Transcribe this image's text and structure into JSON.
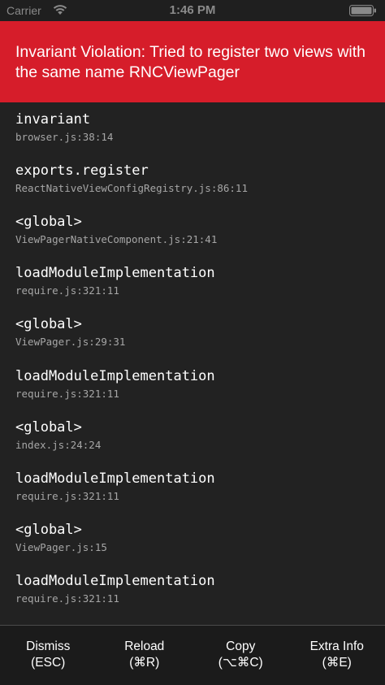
{
  "status_bar": {
    "carrier": "Carrier",
    "time": "1:46 PM",
    "icons": [
      "wifi-icon",
      "battery-icon"
    ]
  },
  "error": {
    "title": "Invariant Violation: Tried to register two views with the same name RNCViewPager",
    "background_color": "#d61d2a"
  },
  "stack": [
    {
      "method": "invariant",
      "location": "browser.js:38:14"
    },
    {
      "method": "exports.register",
      "location": "ReactNativeViewConfigRegistry.js:86:11"
    },
    {
      "method": "<global>",
      "location": "ViewPagerNativeComponent.js:21:41"
    },
    {
      "method": "loadModuleImplementation",
      "location": "require.js:321:11"
    },
    {
      "method": "<global>",
      "location": "ViewPager.js:29:31"
    },
    {
      "method": "loadModuleImplementation",
      "location": "require.js:321:11"
    },
    {
      "method": "<global>",
      "location": "index.js:24:24"
    },
    {
      "method": "loadModuleImplementation",
      "location": "require.js:321:11"
    },
    {
      "method": "<global>",
      "location": "ViewPager.js:15"
    },
    {
      "method": "loadModuleImplementation",
      "location": "require.js:321:11"
    }
  ],
  "toolbar": {
    "dismiss": {
      "label": "Dismiss",
      "shortcut": "(ESC)"
    },
    "reload": {
      "label": "Reload",
      "shortcut": "(⌘R)"
    },
    "copy": {
      "label": "Copy",
      "shortcut": "(⌥⌘C)"
    },
    "extra_info": {
      "label": "Extra Info",
      "shortcut": "(⌘E)"
    }
  }
}
